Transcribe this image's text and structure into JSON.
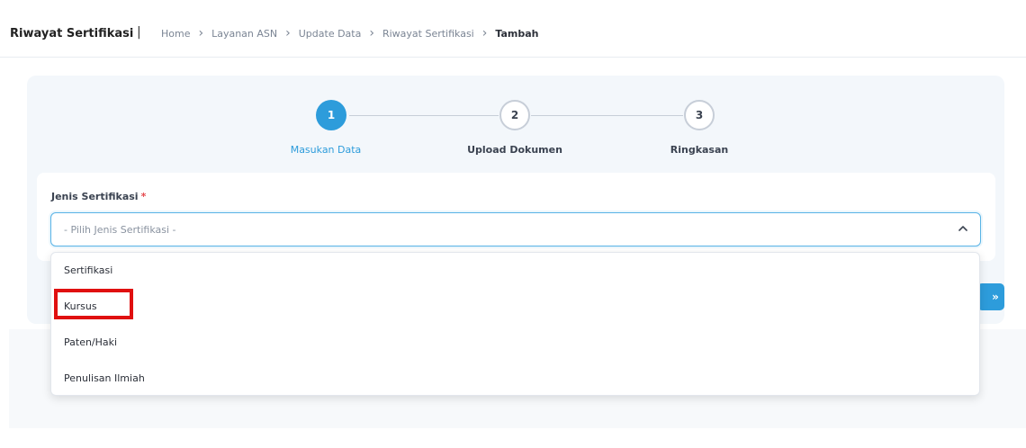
{
  "header": {
    "title": "Riwayat Sertifikasi",
    "separator": "|",
    "breadcrumb": [
      "Home",
      "Layanan ASN",
      "Update Data",
      "Riwayat Sertifikasi",
      "Tambah"
    ]
  },
  "stepper": {
    "steps": [
      {
        "number": "1",
        "label": "Masukan Data",
        "state": "active"
      },
      {
        "number": "2",
        "label": "Upload Dokumen",
        "state": "pending"
      },
      {
        "number": "3",
        "label": "Ringkasan",
        "state": "pending"
      }
    ]
  },
  "form": {
    "field_label": "Jenis Sertifikasi",
    "required_mark": "*",
    "select_placeholder": "- Pilih Jenis Sertifikasi -",
    "select_caret_icon": "chevron-up-icon",
    "options": [
      "Sertifikasi",
      "Kursus",
      "Paten/Haki",
      "Penulisan Ilmiah"
    ],
    "highlighted_option": "Kursus"
  },
  "actions": {
    "next_label": "»",
    "next_icon": "double-chevron-right-icon"
  },
  "colors": {
    "accent": "#2d9cdb",
    "highlight": "#e01010",
    "required": "#e5484d"
  }
}
